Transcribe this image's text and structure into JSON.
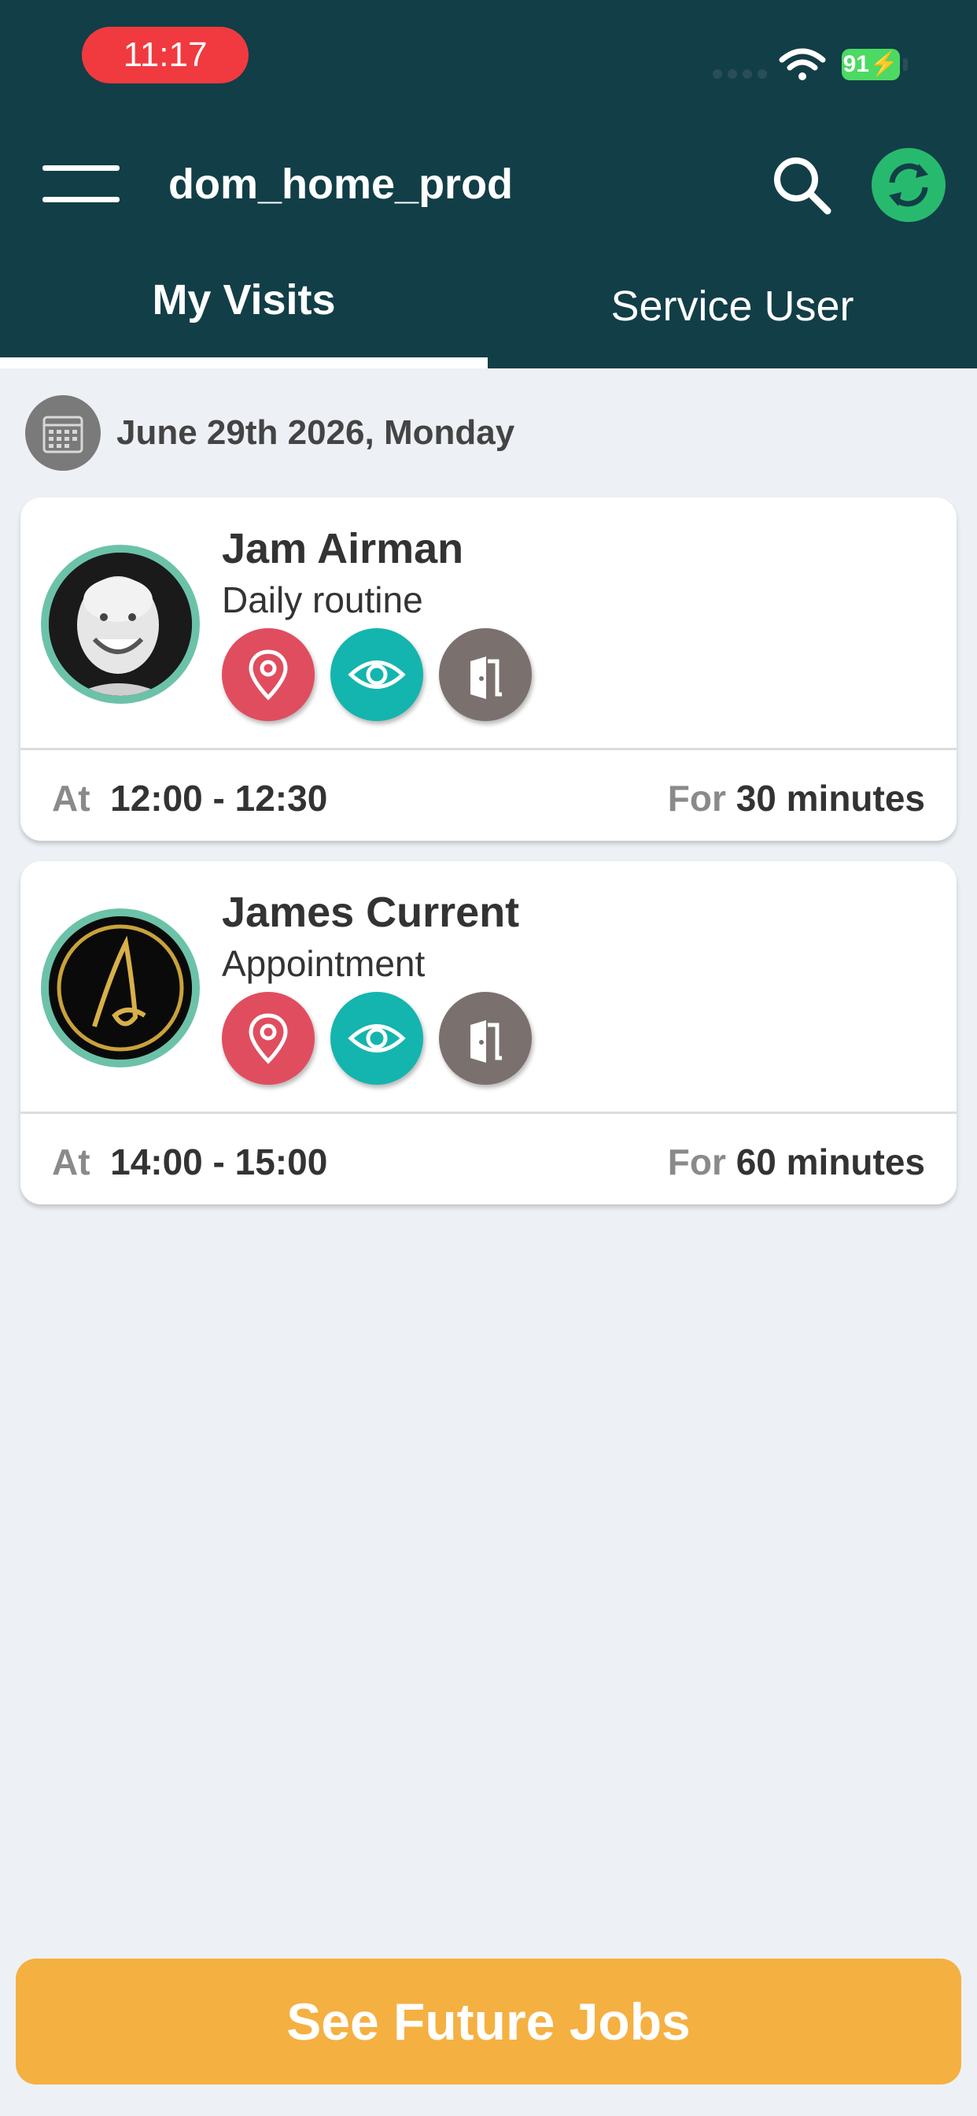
{
  "status_bar": {
    "time": "11:17",
    "battery": "91"
  },
  "header": {
    "title": "dom_home_prod"
  },
  "tabs": [
    {
      "label": "My Visits",
      "active": true
    },
    {
      "label": "Service User",
      "active": false
    }
  ],
  "date_label": "June 29th 2026, Monday",
  "visits": [
    {
      "name": "Jam Airman",
      "subtitle": "Daily routine",
      "at_label": "At",
      "time_range": "12:00 - 12:30",
      "for_label": "For",
      "duration": "30 minutes"
    },
    {
      "name": "James Current",
      "subtitle": "Appointment",
      "at_label": "At",
      "time_range": "14:00 - 15:00",
      "for_label": "For",
      "duration": "60 minutes"
    }
  ],
  "footer": {
    "button_label": "See Future Jobs"
  },
  "colors": {
    "header_bg": "#123e47",
    "accent_teal": "#14b5ae",
    "location_red": "#e04d5f",
    "door_grey": "#7a716e",
    "button_orange": "#f5b042",
    "sync_green": "#27ba6e",
    "avatar_ring": "#6cc2a8"
  },
  "icons": [
    "menu-icon",
    "search-icon",
    "sync-icon",
    "calendar-icon",
    "location-pin-icon",
    "eye-icon",
    "door-icon",
    "wifi-icon",
    "battery-icon"
  ]
}
